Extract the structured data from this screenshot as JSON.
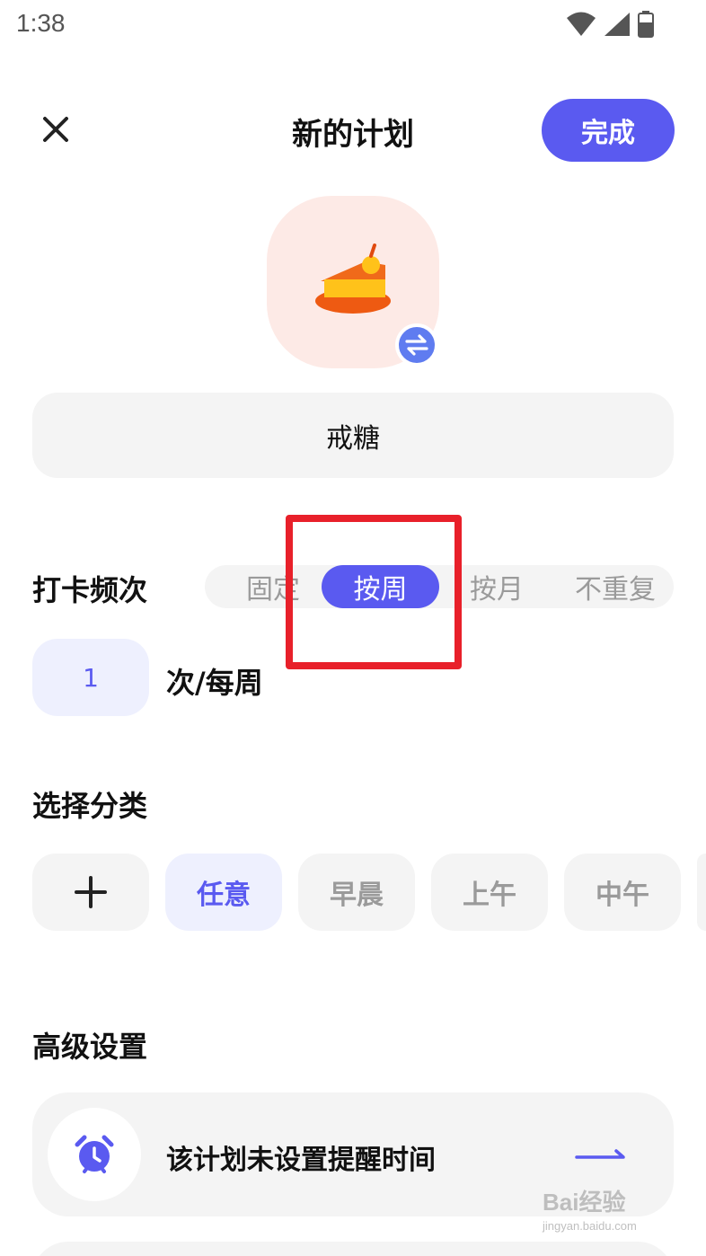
{
  "status_bar": {
    "time": "1:38",
    "icons": [
      "wifi-icon",
      "signal-icon",
      "battery-icon"
    ]
  },
  "header": {
    "title": "新的计划",
    "done_label": "完成",
    "close_icon": "close-icon"
  },
  "plan": {
    "icon": "cake-icon",
    "name": "戒糖",
    "swap_icon": "swap-icon"
  },
  "frequency": {
    "title": "打卡频次",
    "options": [
      "固定",
      "按周",
      "按月",
      "不重复"
    ],
    "selected": "按周",
    "count": "1",
    "unit": "次/每周"
  },
  "category": {
    "title": "选择分类",
    "add_icon": "plus-icon",
    "chips": [
      "任意",
      "早晨",
      "上午",
      "中午"
    ],
    "selected": "任意"
  },
  "advanced": {
    "title": "高级设置",
    "reminder_text": "该计划未设置提醒时间",
    "reminder_icon": "alarm-clock-icon",
    "arrow_icon": "arrow-right-icon"
  },
  "watermark": {
    "main": "Bai经验",
    "sub": "jingyan.baidu.com"
  },
  "colors": {
    "accent": "#5a5af0",
    "highlight_border": "#e8202a",
    "chip_bg": "#f4f4f4",
    "accent_light": "#eef0fe",
    "icon_bg": "#fdeae6"
  }
}
